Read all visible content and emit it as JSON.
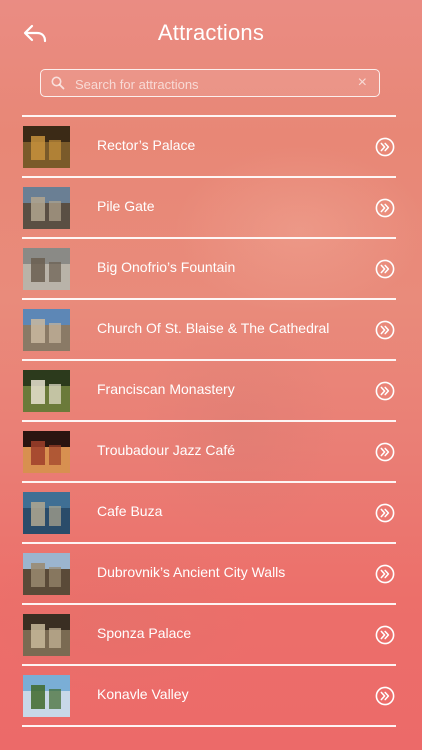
{
  "header": {
    "title": "Attractions",
    "back_icon": "back-arrow-icon"
  },
  "search": {
    "placeholder": "Search for attractions",
    "value": "",
    "clear_symbol": "×"
  },
  "attractions": [
    {
      "label": "Rector’s Palace",
      "thumb": "rectors-palace-photo",
      "colors": [
        "#3b2a16",
        "#c8923c",
        "#7a5a2a"
      ]
    },
    {
      "label": "Pile Gate",
      "thumb": "pile-gate-photo",
      "colors": [
        "#6a7f94",
        "#b2a58e",
        "#5a4f44"
      ]
    },
    {
      "label": "Big Onofrio’s Fountain",
      "thumb": "onofrio-fountain-photo",
      "colors": [
        "#8a8a86",
        "#6a5e50",
        "#b9b3a8"
      ]
    },
    {
      "label": "Church Of St. Blaise & The Cathedral",
      "thumb": "st-blaise-church-photo",
      "colors": [
        "#5d87b6",
        "#c9b8a0",
        "#8a7a66"
      ]
    },
    {
      "label": "Franciscan Monastery",
      "thumb": "franciscan-monastery-photo",
      "colors": [
        "#2c3a1c",
        "#e8e2d0",
        "#6b7a3a"
      ]
    },
    {
      "label": "Troubadour Jazz Café",
      "thumb": "troubadour-cafe-photo",
      "colors": [
        "#2a1410",
        "#a0402a",
        "#d89050"
      ]
    },
    {
      "label": "Cafe Buza",
      "thumb": "cafe-buza-photo",
      "colors": [
        "#3f6f94",
        "#b0a890",
        "#2a4c6a"
      ]
    },
    {
      "label": "Dubrovnik’s Ancient City Walls",
      "thumb": "city-walls-photo",
      "colors": [
        "#9bb5cf",
        "#9a8a70",
        "#5a4a38"
      ]
    },
    {
      "label": "Sponza Palace",
      "thumb": "sponza-palace-photo",
      "colors": [
        "#3a2e22",
        "#c8b89a",
        "#7a6a52"
      ]
    },
    {
      "label": "Konavle Valley",
      "thumb": "konavle-valley-photo",
      "colors": [
        "#7aaed6",
        "#3f6a2c",
        "#c8d8e8"
      ]
    }
  ],
  "row_action_icon": "chevron-circle-right-icon"
}
